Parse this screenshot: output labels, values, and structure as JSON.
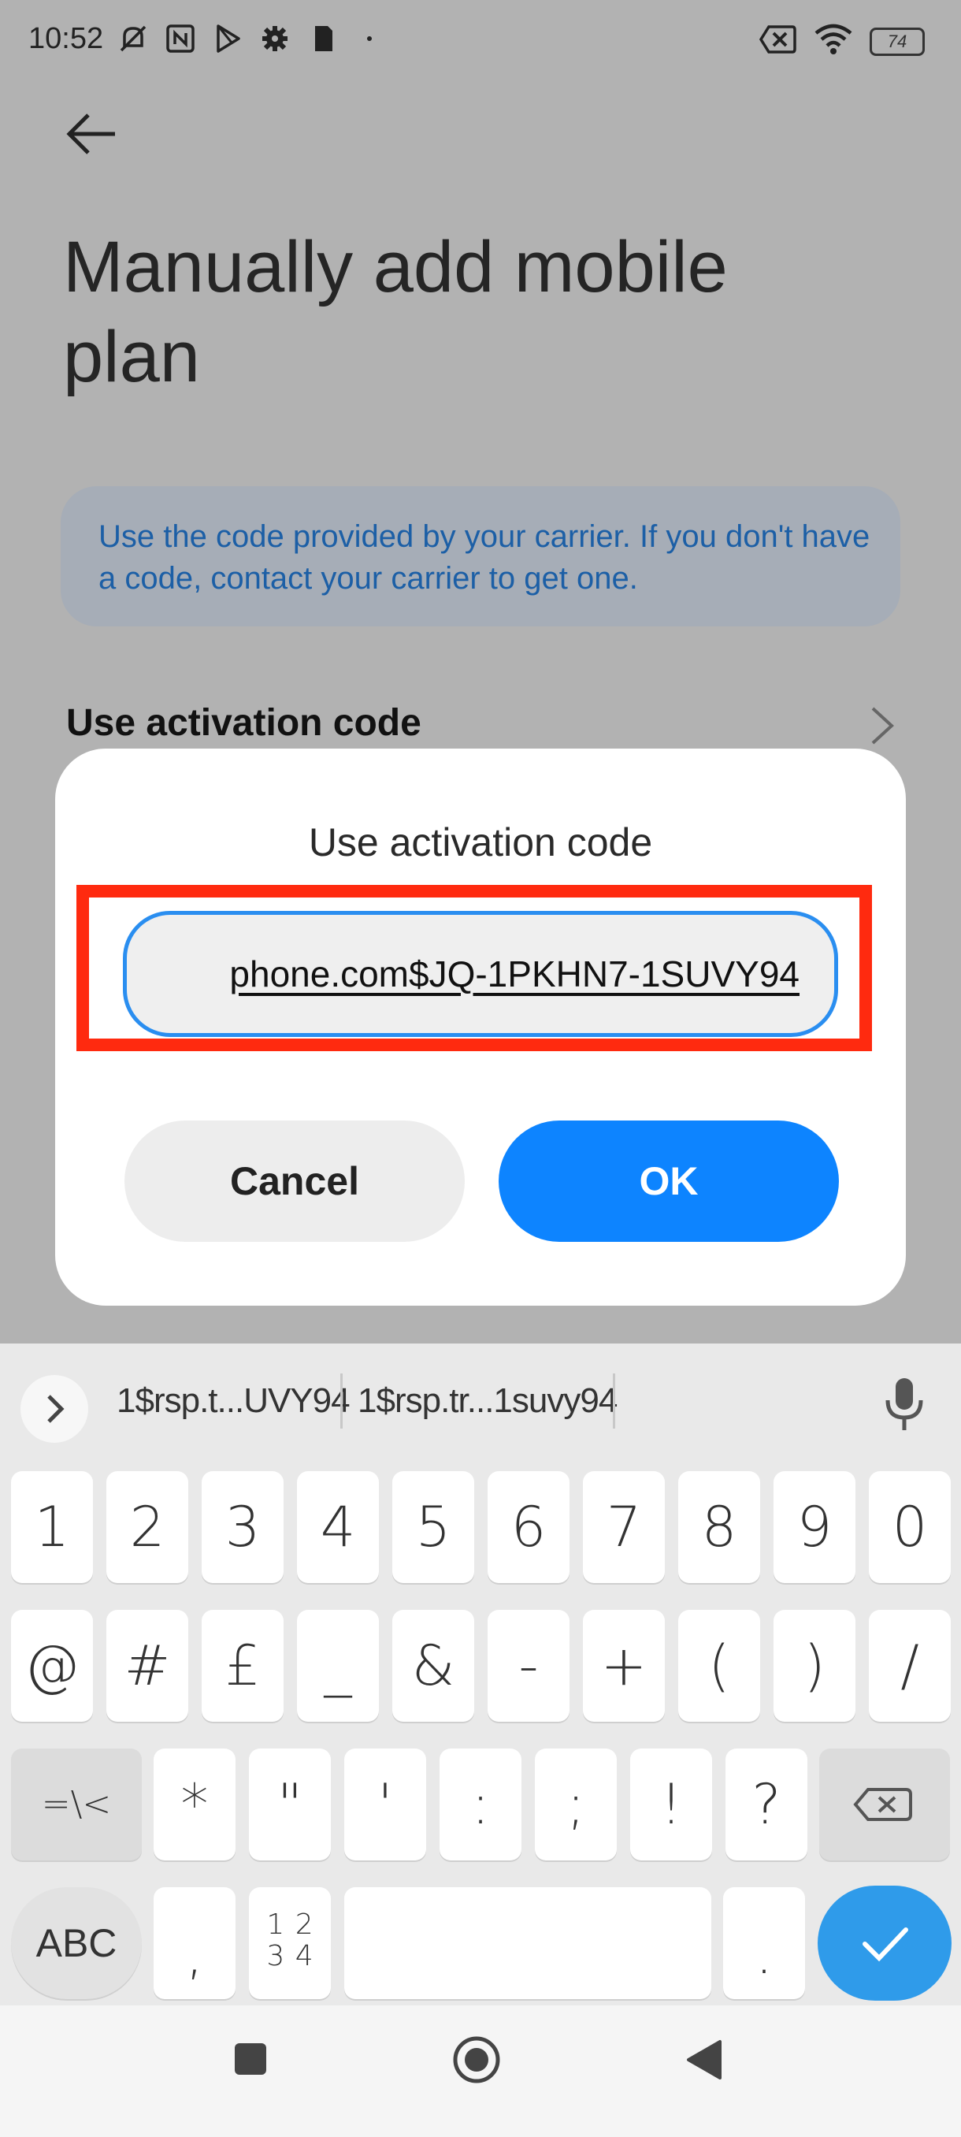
{
  "status_bar": {
    "time": "10:52",
    "battery": "74"
  },
  "page": {
    "title": "Manually add mobile plan",
    "info_text": "Use the code provided by your carrier. If you don't have a code, contact your carrier to get one.",
    "row_label": "Use activation code"
  },
  "dialog": {
    "title": "Use activation code",
    "input_value": "phone.com$JQ-1PKHN7-1SUVY94",
    "cancel_label": "Cancel",
    "ok_label": "OK"
  },
  "keyboard": {
    "suggestions": [
      "1$rsp.t...UVY94",
      "1$rsp.tr...1suvy94"
    ],
    "row1": [
      "1",
      "2",
      "3",
      "4",
      "5",
      "6",
      "7",
      "8",
      "9",
      "0"
    ],
    "row2": [
      "@",
      "#",
      "£",
      "_",
      "&",
      "-",
      "+",
      "(",
      ")",
      "/"
    ],
    "row3": [
      "=\\<",
      "*",
      "\"",
      "'",
      ":",
      ";",
      "!",
      "?"
    ],
    "row4": {
      "abc": "ABC",
      "comma": ",",
      "numpad": "1 2 3 4",
      "period": "."
    }
  },
  "colors": {
    "accent": "#0d84ff",
    "highlight": "#ff2a0f",
    "info_text": "#1c5fa6",
    "enter_key": "#2f9bea"
  },
  "icons": {
    "back": "arrow-left-icon",
    "chevron": "chevron-right-icon",
    "expand": "chevron-right-icon",
    "mic": "microphone-icon",
    "backspace": "backspace-icon",
    "enter": "checkmark-icon"
  }
}
